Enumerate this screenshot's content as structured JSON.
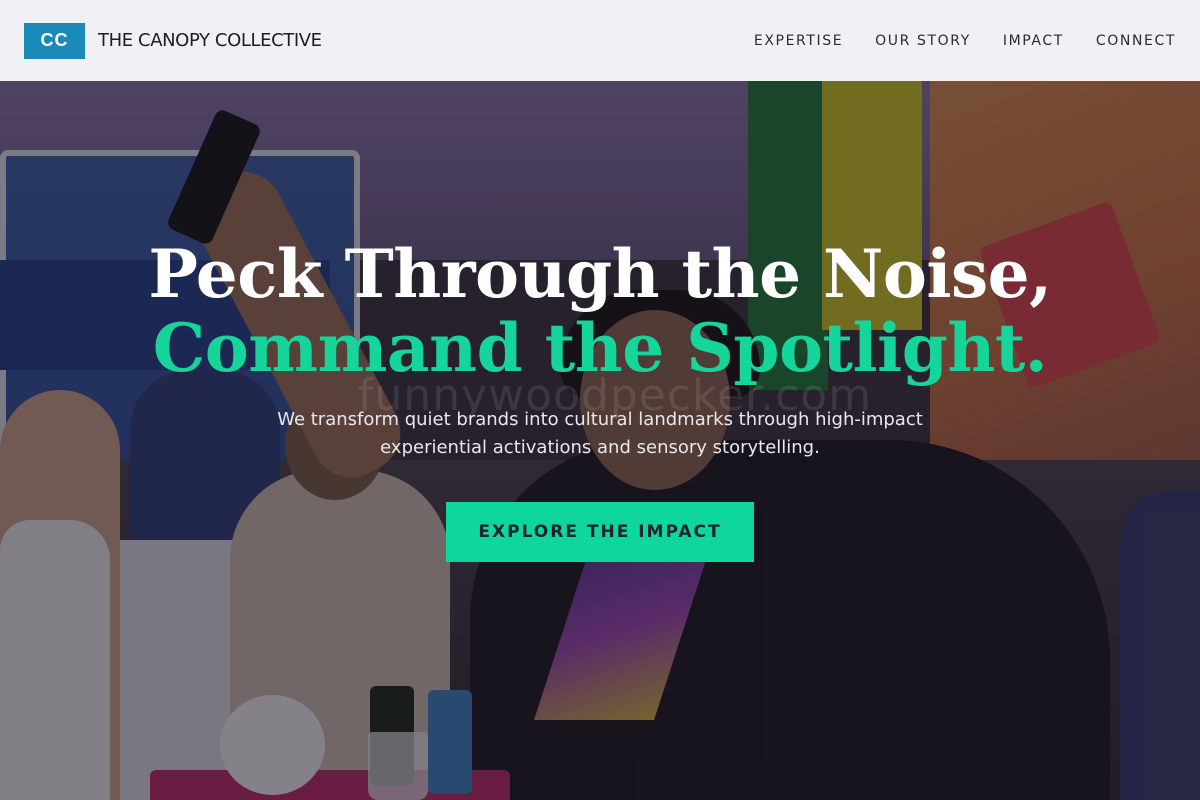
{
  "header": {
    "logo_text": "CC",
    "brand_name": "THE CANOPY COLLECTIVE",
    "nav": [
      {
        "label": "EXPERTISE"
      },
      {
        "label": "OUR STORY"
      },
      {
        "label": "IMPACT"
      },
      {
        "label": "CONNECT"
      }
    ]
  },
  "hero": {
    "headline_line1": "Peck Through the Noise,",
    "headline_line2": "Command the Spotlight.",
    "subtitle": "We transform quiet brands into cultural landmarks through high-impact experiential activations and sensory storytelling.",
    "cta_label": "EXPLORE THE IMPACT",
    "watermark": "funnywoodpecker.com",
    "background_description_icon": "event-crowd-photo"
  },
  "colors": {
    "brand_blue": "#1a8ab8",
    "accent_green": "#15d59a",
    "cta_green": "#0fd69d",
    "header_bg": "#f8f8fa",
    "text_dark": "#1d1d26"
  }
}
